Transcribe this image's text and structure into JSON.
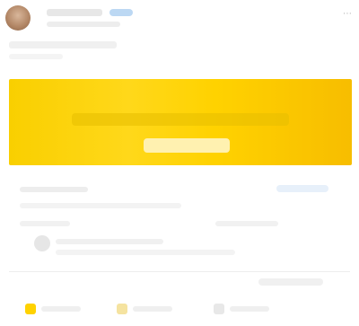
{
  "post": {
    "author": {
      "name": "",
      "meta": ""
    },
    "text_line_1": "",
    "text_line_2": ""
  },
  "banner": {
    "title": "",
    "headline": "",
    "cta": ""
  },
  "link_preview": {
    "domain": "",
    "action": "",
    "description": ""
  },
  "stats": {
    "reactions": "",
    "comments": ""
  },
  "comment": {
    "author": "",
    "text": ""
  },
  "reply_label": "",
  "actions": [
    {
      "label": "",
      "icon": "thumbs-up-icon"
    },
    {
      "label": "",
      "icon": "comment-icon"
    },
    {
      "label": "",
      "icon": "share-icon"
    }
  ],
  "colors": {
    "banner_yellow": "#ffd200",
    "banner_orange": "#f7bd00",
    "link_blue": "#6a8fb9"
  }
}
